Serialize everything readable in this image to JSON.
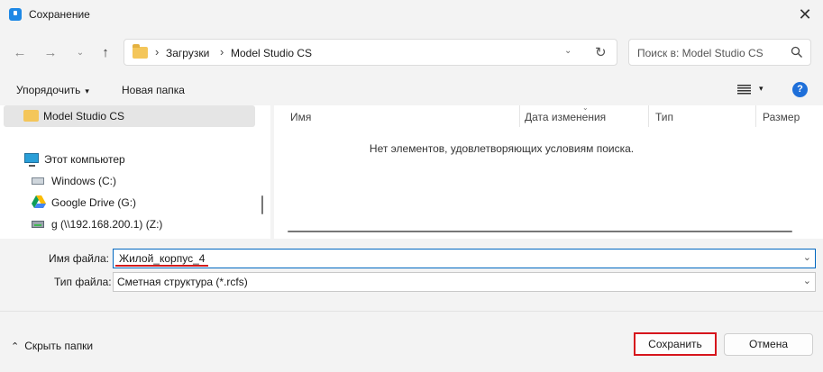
{
  "window": {
    "title": "Сохранение",
    "close_glyph": "✕"
  },
  "nav": {
    "back_glyph": "←",
    "forward_glyph": "→",
    "recent_glyph": "⌄",
    "up_glyph": "↑"
  },
  "address": {
    "breadcrumbs": [
      "Загрузки",
      "Model Studio CS"
    ],
    "separator": "›",
    "dropdown_glyph": "⌄",
    "refresh_glyph": "↻"
  },
  "search": {
    "placeholder": "Поиск в: Model Studio CS"
  },
  "toolbar": {
    "organize_label": "Упорядочить",
    "new_folder_label": "Новая папка",
    "caret_glyph": "▾",
    "help_glyph": "?"
  },
  "sidebar": {
    "selected_folder": "Model Studio CS",
    "this_pc": "Этот компьютер",
    "drives": [
      {
        "label": "Windows (C:)",
        "icon": "drive-icon"
      },
      {
        "label": "Google Drive (G:)",
        "icon": "google-drive-icon"
      },
      {
        "label": "g (\\\\192.168.200.1) (Z:)",
        "icon": "network-drive-icon"
      }
    ]
  },
  "files": {
    "columns": [
      "Имя",
      "Дата изменения",
      "Тип",
      "Размер"
    ],
    "empty_message": "Нет элементов, удовлетворяющих условиям поиска."
  },
  "form": {
    "filename_label": "Имя файла:",
    "filename_value": "Жилой_корпус_4",
    "filetype_label": "Тип файла:",
    "filetype_value": "Сметная структура (*.rcfs)",
    "dropdown_glyph": "⌄"
  },
  "footer": {
    "hide_folders_label": "Скрыть папки",
    "hide_folders_glyph": "⌃",
    "save_label": "Сохранить",
    "cancel_label": "Отмена"
  },
  "colors": {
    "accent": "#0067c0",
    "highlight_red": "#d21b1b",
    "folder_yellow": "#f4c65a"
  }
}
